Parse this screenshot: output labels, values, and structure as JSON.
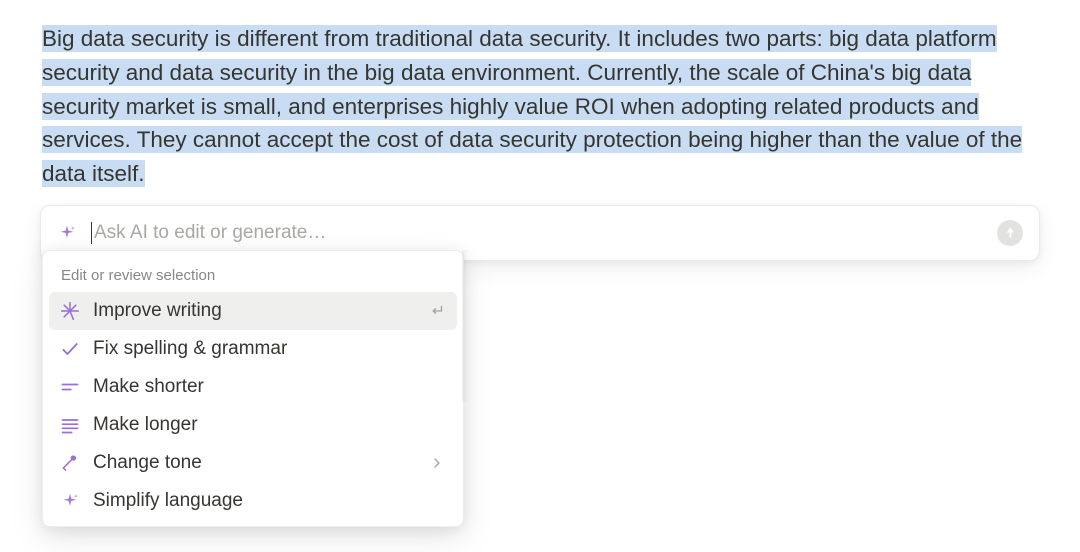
{
  "paragraph": {
    "text": "Big data security is different from traditional data security. It includes two parts: big data platform security and data security in the big data environment. Currently, the scale of China's big data security market is small, and enterprises highly value ROI when adopting related products and services. They cannot accept the cost of data security protection being higher than the value of the data itself."
  },
  "ai_input": {
    "placeholder": "Ask AI to edit or generate…",
    "value": ""
  },
  "menu": {
    "heading": "Edit or review selection",
    "items": [
      {
        "icon": "magic-wand-icon",
        "label": "Improve writing",
        "hover": true,
        "after": "enter"
      },
      {
        "icon": "check-icon",
        "label": "Fix spelling & grammar",
        "hover": false,
        "after": ""
      },
      {
        "icon": "lines-short-icon",
        "label": "Make shorter",
        "hover": false,
        "after": ""
      },
      {
        "icon": "lines-long-icon",
        "label": "Make longer",
        "hover": false,
        "after": ""
      },
      {
        "icon": "microphone-icon",
        "label": "Change tone",
        "hover": false,
        "after": "chevron"
      },
      {
        "icon": "sparkle-icon",
        "label": "Simplify language",
        "hover": false,
        "after": ""
      }
    ]
  },
  "colors": {
    "accent": "#9a6dd7",
    "highlight": "#c8ddf4"
  }
}
